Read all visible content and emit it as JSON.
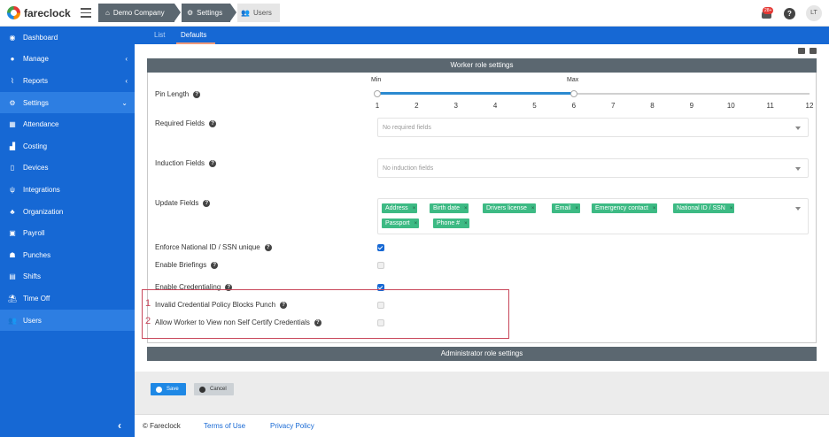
{
  "brand": {
    "name": "fareclock"
  },
  "breadcrumb": [
    {
      "label": "Demo Company",
      "icon": "home-icon"
    },
    {
      "label": "Settings",
      "icon": "gear-icon"
    },
    {
      "label": "Users",
      "icon": "users-icon"
    }
  ],
  "header": {
    "notification_count": "28+",
    "help_label": "?",
    "avatar_initials": "LT"
  },
  "sidebar": {
    "items": [
      {
        "label": "Dashboard",
        "icon": "dashboard-icon"
      },
      {
        "label": "Manage",
        "icon": "person-icon",
        "expandable": true
      },
      {
        "label": "Reports",
        "icon": "chart-icon",
        "expandable": true
      },
      {
        "label": "Settings",
        "icon": "gear-icon",
        "expandable": true,
        "active": true
      },
      {
        "label": "Attendance",
        "icon": "attendance-icon"
      },
      {
        "label": "Costing",
        "icon": "costing-icon"
      },
      {
        "label": "Devices",
        "icon": "device-icon"
      },
      {
        "label": "Integrations",
        "icon": "plug-icon"
      },
      {
        "label": "Organization",
        "icon": "org-icon"
      },
      {
        "label": "Payroll",
        "icon": "payroll-icon"
      },
      {
        "label": "Punches",
        "icon": "punches-icon"
      },
      {
        "label": "Shifts",
        "icon": "shifts-icon"
      },
      {
        "label": "Time Off",
        "icon": "timeoff-icon"
      },
      {
        "label": "Users",
        "icon": "users-icon",
        "selected": true
      }
    ],
    "collapse_glyph": "‹"
  },
  "tabs": [
    {
      "label": "List",
      "active": false
    },
    {
      "label": "Defaults",
      "active": true
    }
  ],
  "worker_section": {
    "title": "Worker role settings"
  },
  "admin_section": {
    "title": "Administrator role settings"
  },
  "pin_length": {
    "label": "Pin Length",
    "min_label": "Min",
    "max_label": "Max",
    "ticks": [
      "1",
      "2",
      "3",
      "4",
      "5",
      "6",
      "7",
      "8",
      "9",
      "10",
      "11",
      "12"
    ],
    "min_value": 1,
    "max_value": 6
  },
  "required_fields": {
    "label": "Required Fields",
    "placeholder": "No required fields"
  },
  "induction_fields": {
    "label": "Induction Fields",
    "placeholder": "No induction fields"
  },
  "update_fields": {
    "label": "Update Fields",
    "chips": [
      "Address",
      "Birth date",
      "Drivers license",
      "Email",
      "Emergency contact",
      "National ID / SSN",
      "Passport",
      "Phone #"
    ]
  },
  "toggles": [
    {
      "label": "Enforce National ID / SSN unique",
      "checked": true
    },
    {
      "label": "Enable Briefings",
      "checked": false
    },
    {
      "label": "Enable Credentialing",
      "checked": true
    },
    {
      "label": "Invalid Credential Policy Blocks Punch",
      "checked": false
    },
    {
      "label": "Allow Worker to View non Self Certify Credentials",
      "checked": false
    }
  ],
  "annotations": [
    "1",
    "2"
  ],
  "actions": {
    "save_label": "Save",
    "cancel_label": "Cancel"
  },
  "footer": {
    "copyright": "© Fareclock",
    "terms": "Terms of Use",
    "privacy": "Privacy Policy"
  },
  "colors": {
    "primary": "#1668d4",
    "section_bar": "#5b6770",
    "chip": "#3dba84",
    "annotation": "#c8465a"
  }
}
